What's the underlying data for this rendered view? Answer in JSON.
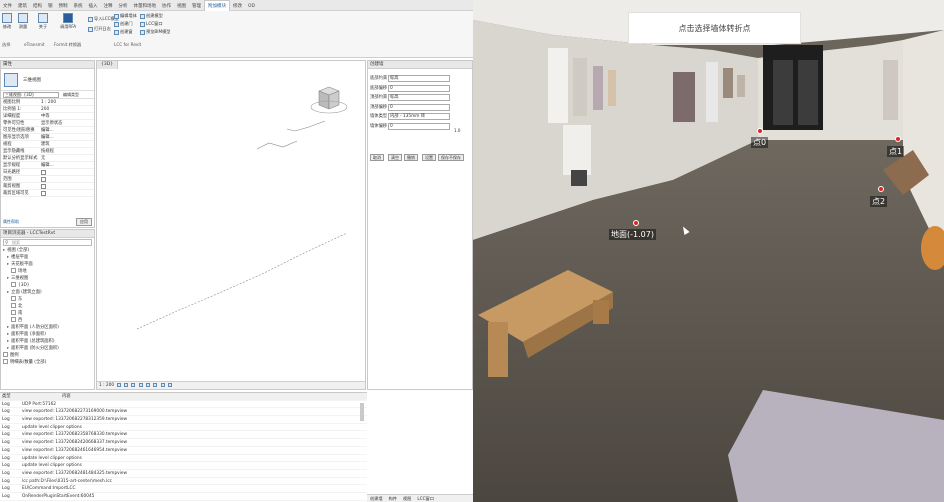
{
  "ribbon": {
    "tabs": [
      "文件",
      "建筑",
      "结构",
      "钢",
      "预制",
      "系统",
      "插入",
      "注释",
      "分析",
      "体量和场地",
      "协作",
      "视图",
      "管理",
      "附加模块",
      "修改",
      "OD"
    ],
    "active_tab": "附加模块",
    "buttons": {
      "modify": "修改",
      "select": "选择",
      "convert_lcc": "导入LCC模型",
      "relink_rvt": "重新链接RVT",
      "lcc_model": "LCC模型",
      "create_lcc": "创建LCC模型",
      "measure": "测量",
      "about": "关于",
      "ref_rfa": "调用RFA",
      "revit_lcc": "Revit-LCC",
      "open_log": "打开日志",
      "align": "编辑墙体",
      "wall_edit": "编辑墙体",
      "create_door": "创建门",
      "create_window": "创建窗",
      "create_model": "创建模型",
      "lcc_window": "LCC窗口",
      "preview": "预览BIM模型"
    },
    "groups": [
      "选择",
      "eTransmit",
      "Formit 转换器",
      "LCC for Revit"
    ]
  },
  "properties": {
    "title": "属性",
    "type_name": "三维视图",
    "dropdown": "三维视图: {3D}",
    "edit_type": "编辑类型",
    "rows": [
      {
        "label": "视图比例",
        "value": "1 : 200"
      },
      {
        "label": "比例值 1:",
        "value": "200"
      },
      {
        "label": "详细程度",
        "value": "中等"
      },
      {
        "label": "零件可见性",
        "value": "显示原状态"
      },
      {
        "label": "可见性/图形替换",
        "value": "编辑..."
      },
      {
        "label": "图形显示选项",
        "value": "编辑..."
      },
      {
        "label": "规程",
        "value": "建筑"
      },
      {
        "label": "显示隐藏线",
        "value": "按规程"
      },
      {
        "label": "默认分析显示样式",
        "value": "无"
      },
      {
        "label": "显示规程",
        "value": "编辑..."
      },
      {
        "label": "日光路径",
        "value": ""
      },
      {
        "label": "范围",
        "value": ""
      },
      {
        "label": "裁剪视图",
        "value": ""
      },
      {
        "label": "裁剪区域可见",
        "value": ""
      }
    ],
    "help": "属性帮助",
    "apply": "应用"
  },
  "project_browser": {
    "title": "项目浏览器 - LCCTestRvt",
    "search_placeholder": "搜索",
    "items": [
      "视图 (全部)",
      "楼层平面",
      "天花板平面",
      "场地",
      "三维视图",
      "{3D}",
      "立面 (建筑立面)",
      "东",
      "北",
      "南",
      "西",
      "面积平面 (人防分区面积)",
      "面积平面 (净面积)",
      "面积平面 (总建筑面积)",
      "面积平面 (防火分区面积)",
      "图例",
      "明细表/数量 (全部)"
    ]
  },
  "view3d": {
    "tab": "{3D}",
    "scale": "1 : 200",
    "cancel_hint": "取消"
  },
  "wall_form": {
    "title": "创建墙",
    "fields": [
      {
        "label": "底部约束",
        "value": "标高"
      },
      {
        "label": "底部偏移",
        "value": "0"
      },
      {
        "label": "顶部约束",
        "value": "标高"
      },
      {
        "label": "顶部偏移",
        "value": "0"
      },
      {
        "label": "墙体类型",
        "value": "内部 - 135mm 砖"
      },
      {
        "label": "墙体偏移",
        "value": "0"
      }
    ],
    "unit": "1.0",
    "buttons": [
      "取消",
      "清空",
      "撤销",
      "设置",
      "保存不保存"
    ]
  },
  "log": {
    "col_type": "类型",
    "col_msg": "内容",
    "rows": [
      {
        "type": "Log",
        "msg": "UDP Port:57162"
      },
      {
        "type": "Log",
        "msg": "view exported: 133720682273169000.tempview"
      },
      {
        "type": "Log",
        "msg": "view exported: 133720682278312359.tempview"
      },
      {
        "type": "Log",
        "msg": "update level clipper options"
      },
      {
        "type": "Log",
        "msg": "view exported: 133720682358768330.tempview"
      },
      {
        "type": "Log",
        "msg": "view exported: 133720682420668337.tempview"
      },
      {
        "type": "Log",
        "msg": "view exported: 133720682461646954.tempview"
      },
      {
        "type": "Log",
        "msg": "update level clipper options"
      },
      {
        "type": "Log",
        "msg": "update level clipper options"
      },
      {
        "type": "Log",
        "msg": "view exported: 133720682481484325.tempview"
      },
      {
        "type": "Log",
        "msg": "lcc path:D:\\Files\\0315-art-center\\mesh.lcc"
      },
      {
        "type": "Log",
        "msg": "EU\\Command:ImportLCC"
      },
      {
        "type": "Log",
        "msg": "OnRenderPluginStartEvent:60045"
      }
    ],
    "bottom_tabs": [
      "创建墙",
      "构件",
      "视图",
      "LCC窗口"
    ]
  },
  "photo": {
    "hint": "点击选择墙体转折点",
    "points": [
      {
        "id": "p0",
        "label": "点0"
      },
      {
        "id": "p1",
        "label": "点1"
      },
      {
        "id": "p2",
        "label": "点2"
      }
    ],
    "ground_label": "地面(-1.07)"
  },
  "colors": {
    "accent": "#1a5a9c",
    "marker": "#e02424",
    "floor": "#5a544c",
    "wall": "#e6e4de"
  }
}
